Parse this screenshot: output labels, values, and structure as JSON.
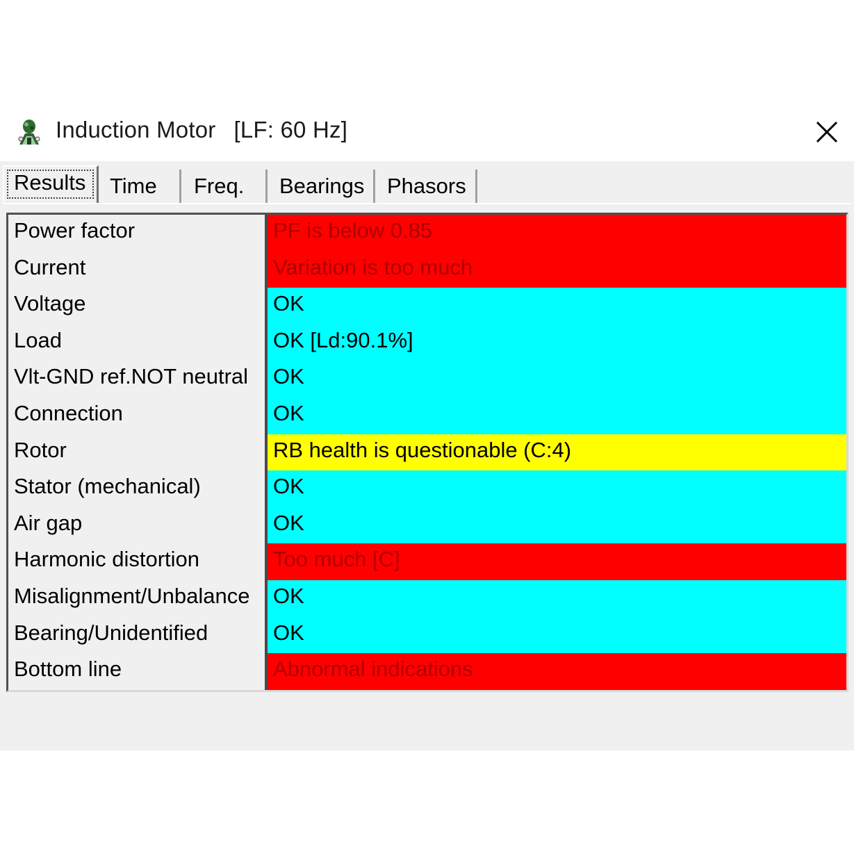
{
  "window": {
    "title": "Induction Motor",
    "subtitle": "[LF: 60 Hz]",
    "app_icon": "motor-logo-icon",
    "close_icon": "close-icon"
  },
  "tabs": [
    {
      "label": "Results",
      "active": true
    },
    {
      "label": "Time",
      "active": false
    },
    {
      "label": "Freq.",
      "active": false
    },
    {
      "label": "Bearings",
      "active": false
    },
    {
      "label": "Phasors",
      "active": false
    }
  ],
  "colors": {
    "bad": "#ff0000",
    "ok": "#00ffff",
    "warn": "#ffff00"
  },
  "results": [
    {
      "label": "Power factor",
      "value": "PF is below 0.85",
      "status": "bad"
    },
    {
      "label": "Current",
      "value": "Variation is too much",
      "status": "bad"
    },
    {
      "label": "Voltage",
      "value": "OK",
      "status": "ok"
    },
    {
      "label": "Load",
      "value": "OK [Ld:90.1%]",
      "status": "ok"
    },
    {
      "label": "Vlt-GND ref.NOT neutral",
      "value": "OK",
      "status": "ok"
    },
    {
      "label": "Connection",
      "value": "OK",
      "status": "ok"
    },
    {
      "label": "Rotor",
      "value": "RB health is questionable (C:4)",
      "status": "warn"
    },
    {
      "label": "Stator (mechanical)",
      "value": "OK",
      "status": "ok"
    },
    {
      "label": "Air gap",
      "value": "OK",
      "status": "ok"
    },
    {
      "label": "Harmonic distortion",
      "value": "Too much [C]",
      "status": "bad"
    },
    {
      "label": "Misalignment/Unbalance",
      "value": "OK",
      "status": "ok"
    },
    {
      "label": "Bearing/Unidentified",
      "value": "OK",
      "status": "ok"
    },
    {
      "label": "Bottom line",
      "value": "Abnormal indications",
      "status": "bad"
    }
  ]
}
